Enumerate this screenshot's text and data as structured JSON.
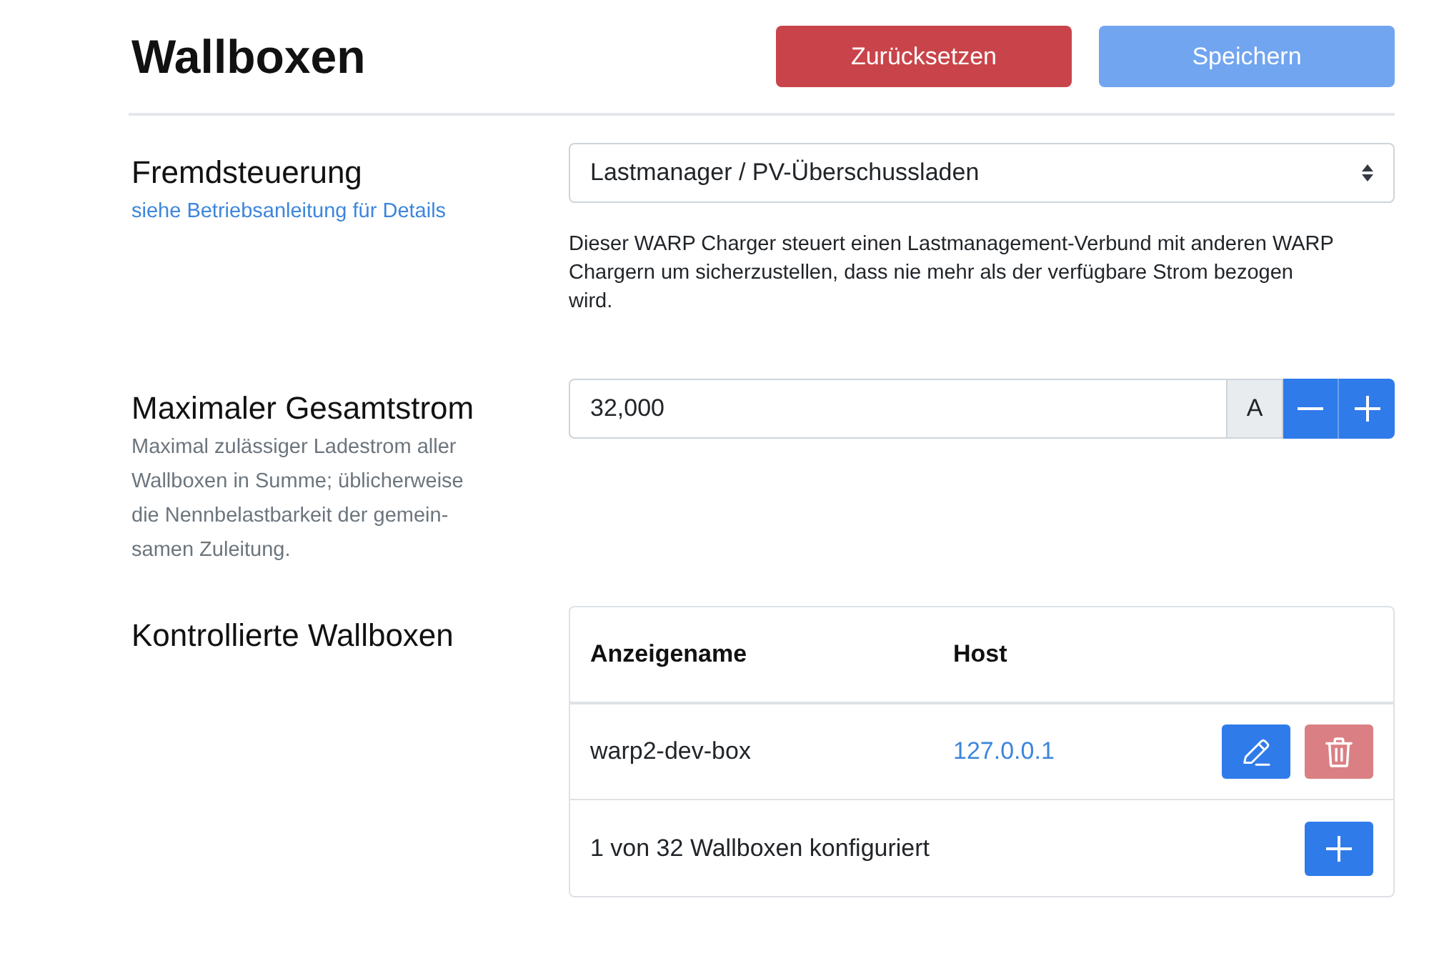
{
  "page": {
    "title": "Wallboxen"
  },
  "actions": [
    {
      "label": "Zurücksetzen",
      "kind": "reset",
      "disabled": false
    },
    {
      "label": "Speichern",
      "kind": "save",
      "disabled": true
    }
  ],
  "sections": [
    {
      "kind": "select",
      "label": "Fremdsteuerung",
      "link": "siehe Betriebsanleitung für Details",
      "value": "Lastmanager / PV-Überschussladen",
      "help": "Dieser WARP Charger steuert einen Lastmanagement-Verbund mit anderen WARP Chargern um sicherzustellen, dass nie mehr als der verfügbare Strom bezogen wird."
    },
    {
      "kind": "number",
      "label": "Maximaler Gesamtstrom",
      "description": "Maximal zulässiger Ladestrom aller Wallboxen in Summe; üblicherweise die Nennbelastbarkeit der gemein-samen Zuleitung.",
      "value": "32,000",
      "unit": "A"
    },
    {
      "kind": "table",
      "label": "Kontrollierte Wallboxen",
      "columns": [
        "Anzeigename",
        "Host"
      ],
      "rows": [
        {
          "name": "warp2-dev-box",
          "host": "127.0.0.1",
          "delete_disabled": true
        }
      ],
      "footer": "1 von 32 Wallboxen konfiguriert"
    }
  ]
}
